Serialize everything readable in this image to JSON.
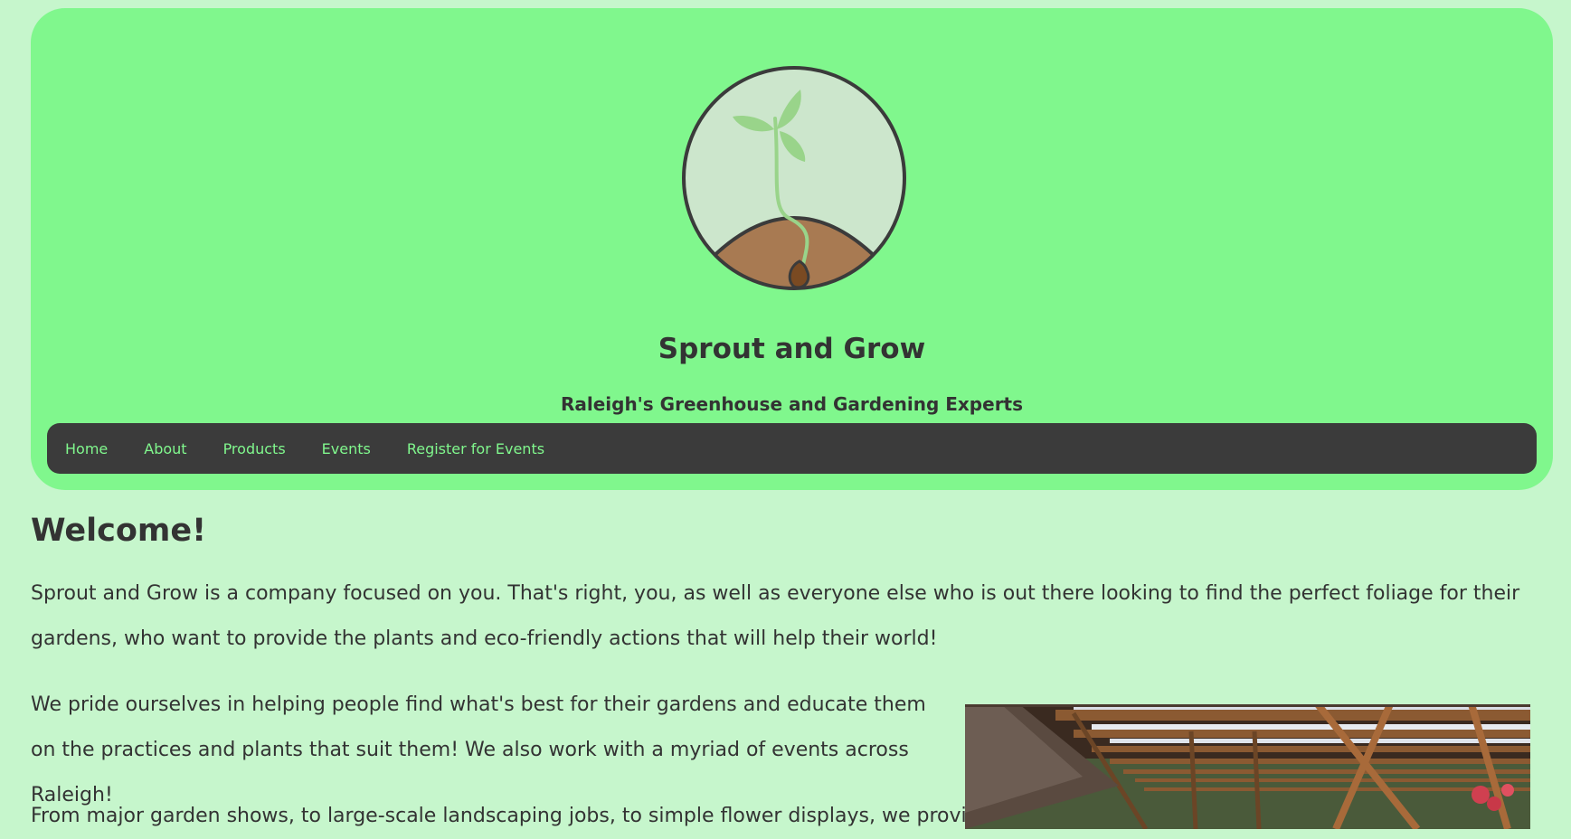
{
  "header": {
    "title": "Sprout and Grow",
    "tagline": "Raleigh's Greenhouse and Gardening Experts",
    "logo_icon": "sprout-logo-icon"
  },
  "nav": {
    "items": [
      {
        "label": "Home"
      },
      {
        "label": "About"
      },
      {
        "label": "Products"
      },
      {
        "label": "Events"
      },
      {
        "label": "Register for Events"
      }
    ]
  },
  "main": {
    "heading": "Welcome!",
    "paragraphs": [
      "Sprout and Grow is a company focused on you. That's right, you, as well as everyone else who is out there looking to find the perfect foliage for their gardens, who want to provide the plants and eco-friendly actions that will help their world!",
      "We pride ourselves in helping people find what's best for their gardens and educate them on the practices and plants that suit them! We also work with a myriad of events across Raleigh!",
      "From major garden shows, to large-scale landscaping jobs, to simple flower displays, we provide"
    ],
    "image_icon": "greenhouse-pergola-image"
  },
  "colors": {
    "page_background": "#c6f6cc",
    "header_background": "#80f78d",
    "nav_background": "#3b3b3b",
    "nav_text": "#80f78d",
    "text": "#333333"
  }
}
